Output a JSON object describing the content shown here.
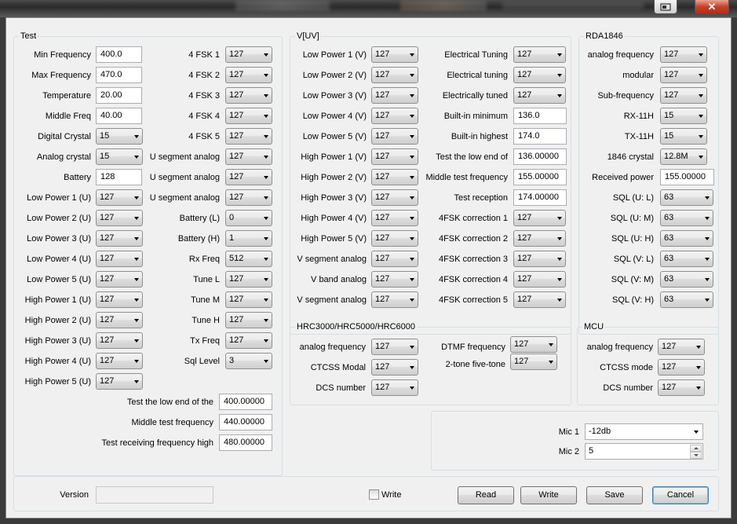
{
  "window": {
    "restore_icon": "restore-icon",
    "close_icon": "close-icon",
    "close_glyph": "✕"
  },
  "groups": {
    "test": "Test",
    "vuv": "V[UV]",
    "rda": "RDA1846",
    "hrc": "HRC3000/HRC5000/HRC6000",
    "mcu": "MCU"
  },
  "test": {
    "min_freq": {
      "label": "Min Frequency",
      "value": "400.0"
    },
    "max_freq": {
      "label": "Max Frequency",
      "value": "470.0"
    },
    "temperature": {
      "label": "Temperature",
      "value": "20.00"
    },
    "middle_freq": {
      "label": "Middle Freq",
      "value": "40.00"
    },
    "digital_crystal": {
      "label": "Digital Crystal",
      "value": "15"
    },
    "analog_crystal": {
      "label": "Analog crystal",
      "value": "15"
    },
    "battery": {
      "label": "Battery",
      "value": "128"
    },
    "left_combos": [
      {
        "label": "Low Power 1 (U)",
        "value": "127"
      },
      {
        "label": "Low Power 2 (U)",
        "value": "127"
      },
      {
        "label": "Low Power 3 (U)",
        "value": "127"
      },
      {
        "label": "Low Power 4 (U)",
        "value": "127"
      },
      {
        "label": "Low Power 5 (U)",
        "value": "127"
      },
      {
        "label": "High Power 1 (U)",
        "value": "127"
      },
      {
        "label": "High Power 2 (U)",
        "value": "127"
      },
      {
        "label": "High Power 3 (U)",
        "value": "127"
      },
      {
        "label": "High Power 4 (U)",
        "value": "127"
      },
      {
        "label": "High Power 5 (U)",
        "value": "127"
      }
    ],
    "right_combos": [
      {
        "label": "4 FSK 1",
        "value": "127"
      },
      {
        "label": "4 FSK 2",
        "value": "127"
      },
      {
        "label": "4 FSK 3",
        "value": "127"
      },
      {
        "label": "4 FSK 4",
        "value": "127"
      },
      {
        "label": "4 FSK 5",
        "value": "127"
      },
      {
        "label": "U segment analog",
        "value": "127"
      },
      {
        "label": "U segment analog",
        "value": "127"
      },
      {
        "label": "U segment analog",
        "value": "127"
      },
      {
        "label": "Battery (L)",
        "value": "0"
      },
      {
        "label": "Battery (H)",
        "value": "1"
      },
      {
        "label": "Rx Freq",
        "value": "512"
      },
      {
        "label": "Tune L",
        "value": "127"
      },
      {
        "label": "Tune M",
        "value": "127"
      },
      {
        "label": "Tune H",
        "value": "127"
      },
      {
        "label": "Tx Freq",
        "value": "127"
      },
      {
        "label": "Sql Level",
        "value": "3"
      }
    ],
    "bottom_fields": [
      {
        "label": "Test the low end of the",
        "value": "400.00000"
      },
      {
        "label": "Middle test frequency",
        "value": "440.00000"
      },
      {
        "label": "Test receiving frequency high",
        "value": "480.00000"
      }
    ]
  },
  "vuv": {
    "left_combos": [
      {
        "label": "Low Power 1 (V)",
        "value": "127"
      },
      {
        "label": "Low Power 2 (V)",
        "value": "127"
      },
      {
        "label": "Low Power 3 (V)",
        "value": "127"
      },
      {
        "label": "Low Power 4 (V)",
        "value": "127"
      },
      {
        "label": "Low Power 5 (V)",
        "value": "127"
      },
      {
        "label": "High Power 1 (V)",
        "value": "127"
      },
      {
        "label": "High Power 2 (V)",
        "value": "127"
      },
      {
        "label": "High Power 3 (V)",
        "value": "127"
      },
      {
        "label": "High Power 4 (V)",
        "value": "127"
      },
      {
        "label": "High Power 5 (V)",
        "value": "127"
      },
      {
        "label": "V segment analog",
        "value": "127"
      },
      {
        "label": "V band analog",
        "value": "127"
      },
      {
        "label": "V segment analog",
        "value": "127"
      }
    ],
    "right_items": [
      {
        "label": "Electrical Tuning",
        "value": "127",
        "kind": "combo"
      },
      {
        "label": "Electrical tuning",
        "value": "127",
        "kind": "combo"
      },
      {
        "label": "Electrically tuned",
        "value": "127",
        "kind": "combo"
      },
      {
        "label": "Built-in minimum",
        "value": "136.0",
        "kind": "text"
      },
      {
        "label": "Built-in highest",
        "value": "174.0",
        "kind": "text"
      },
      {
        "label": "Test the low end of",
        "value": "136.00000",
        "kind": "text"
      },
      {
        "label": "Middle test frequency",
        "value": "155.00000",
        "kind": "text"
      },
      {
        "label": "Test reception",
        "value": "174.00000",
        "kind": "text"
      },
      {
        "label": "4FSK correction 1",
        "value": "127",
        "kind": "combo"
      },
      {
        "label": "4FSK correction 2",
        "value": "127",
        "kind": "combo"
      },
      {
        "label": "4FSK correction 3",
        "value": "127",
        "kind": "combo"
      },
      {
        "label": "4FSK correction 4",
        "value": "127",
        "kind": "combo"
      },
      {
        "label": "4FSK correction 5",
        "value": "127",
        "kind": "combo"
      }
    ]
  },
  "rda": {
    "items": [
      {
        "label": "analog frequency",
        "value": "127",
        "kind": "combo"
      },
      {
        "label": "modular",
        "value": "127",
        "kind": "combo"
      },
      {
        "label": "Sub-frequency",
        "value": "127",
        "kind": "combo"
      },
      {
        "label": "RX-11H",
        "value": "15",
        "kind": "combo"
      },
      {
        "label": "TX-11H",
        "value": "15",
        "kind": "combo"
      },
      {
        "label": "1846 crystal",
        "value": "12.8M",
        "kind": "combo"
      },
      {
        "label": "Received power",
        "value": "155.00000",
        "kind": "text"
      },
      {
        "label": "SQL (U: L)",
        "value": "63",
        "kind": "combo"
      },
      {
        "label": "SQL (U: M)",
        "value": "63",
        "kind": "combo"
      },
      {
        "label": "SQL (U: H)",
        "value": "63",
        "kind": "combo"
      },
      {
        "label": "SQL (V: L)",
        "value": "63",
        "kind": "combo"
      },
      {
        "label": "SQL (V: M)",
        "value": "63",
        "kind": "combo"
      },
      {
        "label": "SQL (V: H)",
        "value": "63",
        "kind": "combo"
      }
    ]
  },
  "hrc": {
    "left": [
      {
        "label": "analog frequency",
        "value": "127"
      },
      {
        "label": "CTCSS Modal",
        "value": "127"
      },
      {
        "label": "DCS number",
        "value": "127"
      }
    ],
    "right": [
      {
        "label": "DTMF frequency",
        "value": "127"
      },
      {
        "label": "2-tone five-tone",
        "value": "127"
      }
    ]
  },
  "mcu": {
    "items": [
      {
        "label": "analog frequency",
        "value": "127"
      },
      {
        "label": "CTCSS mode",
        "value": "127"
      },
      {
        "label": "DCS number",
        "value": "127"
      }
    ]
  },
  "mic": {
    "mic1_label": "Mic 1",
    "mic1_value": "-12db",
    "mic2_label": "Mic 2",
    "mic2_value": "5"
  },
  "footer": {
    "version_label": "Version",
    "version_value": "",
    "write_check_label": "Write",
    "write_checked": false,
    "read_button": "Read",
    "write_button": "Write",
    "save_button": "Save",
    "cancel_button": "Cancel"
  }
}
